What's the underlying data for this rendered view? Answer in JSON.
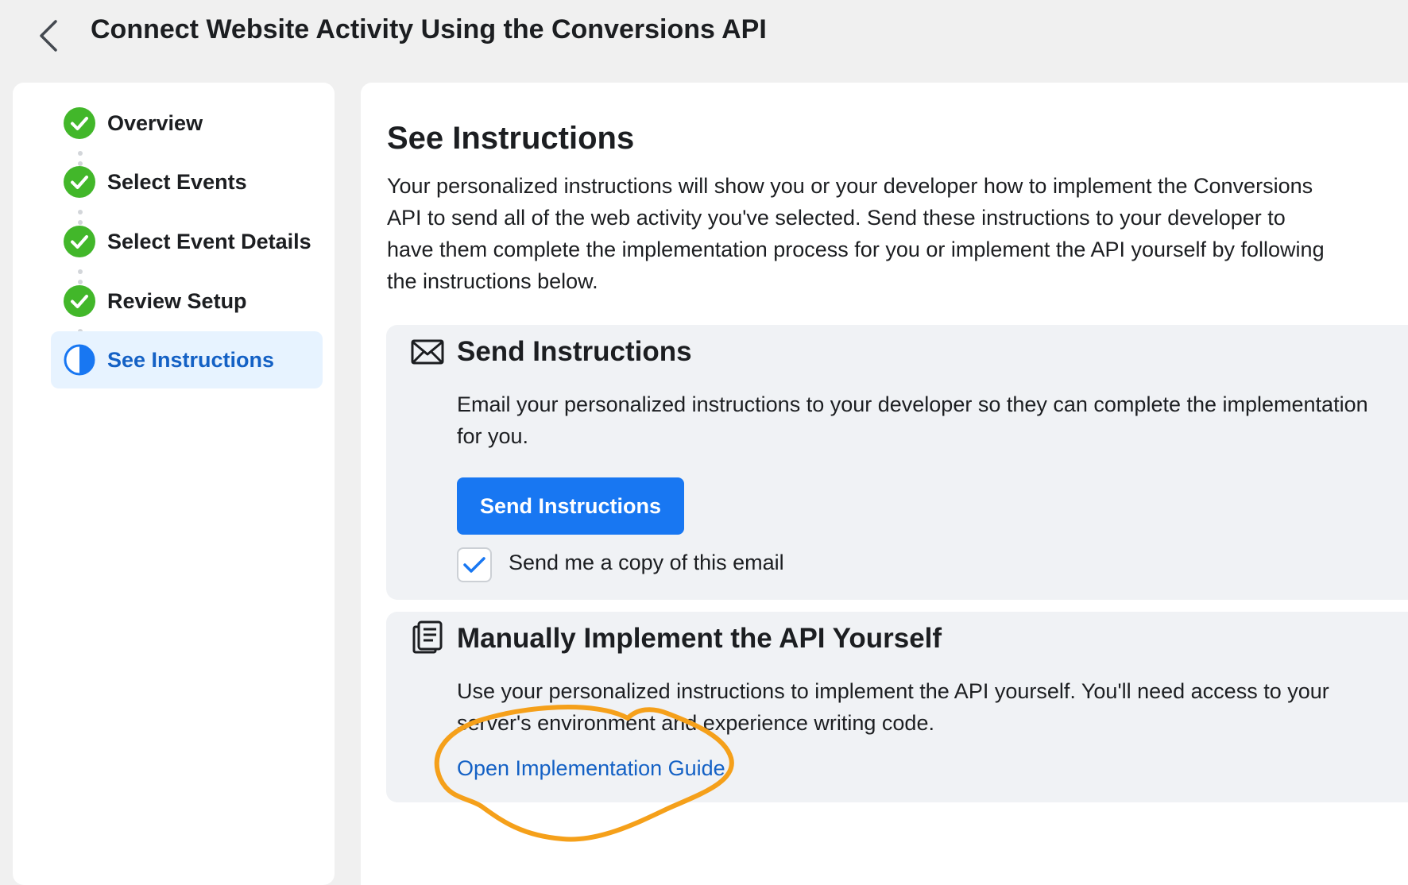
{
  "header": {
    "title": "Connect Website Activity Using the Conversions API",
    "back_icon": "chevron-left-icon"
  },
  "sidebar": {
    "steps": [
      {
        "label": "Overview",
        "status": "complete",
        "icon": "check-circle-icon"
      },
      {
        "label": "Select Events",
        "status": "complete",
        "icon": "check-circle-icon"
      },
      {
        "label": "Select Event Details",
        "status": "complete",
        "icon": "check-circle-icon"
      },
      {
        "label": "Review Setup",
        "status": "complete",
        "icon": "check-circle-icon"
      },
      {
        "label": "See Instructions",
        "status": "in-progress",
        "icon": "half-circle-icon"
      }
    ]
  },
  "main": {
    "title": "See Instructions",
    "description": "Your personalized instructions will show you or your developer how to implement the Conversions API to send all of the web activity you've selected. Send these instructions to your developer to have them complete the implementation process for you or implement the API yourself by following the instructions below.",
    "send_card": {
      "icon": "envelope-icon",
      "title": "Send Instructions",
      "description": "Email your personalized instructions to your developer so they can complete the implementation for you.",
      "button_label": "Send Instructions",
      "checkbox_label": "Send me a copy of this email",
      "checkbox_checked": true
    },
    "manual_card": {
      "icon": "document-icon",
      "title": "Manually Implement the API Yourself",
      "description": "Use your personalized instructions to implement the API yourself. You'll need access to your server's environment and experience writing code.",
      "link_label": "Open Implementation Guide"
    }
  },
  "colors": {
    "accent": "#1877f2",
    "link": "#1461c5",
    "success": "#42b72a",
    "annotation": "#f5a01a"
  }
}
